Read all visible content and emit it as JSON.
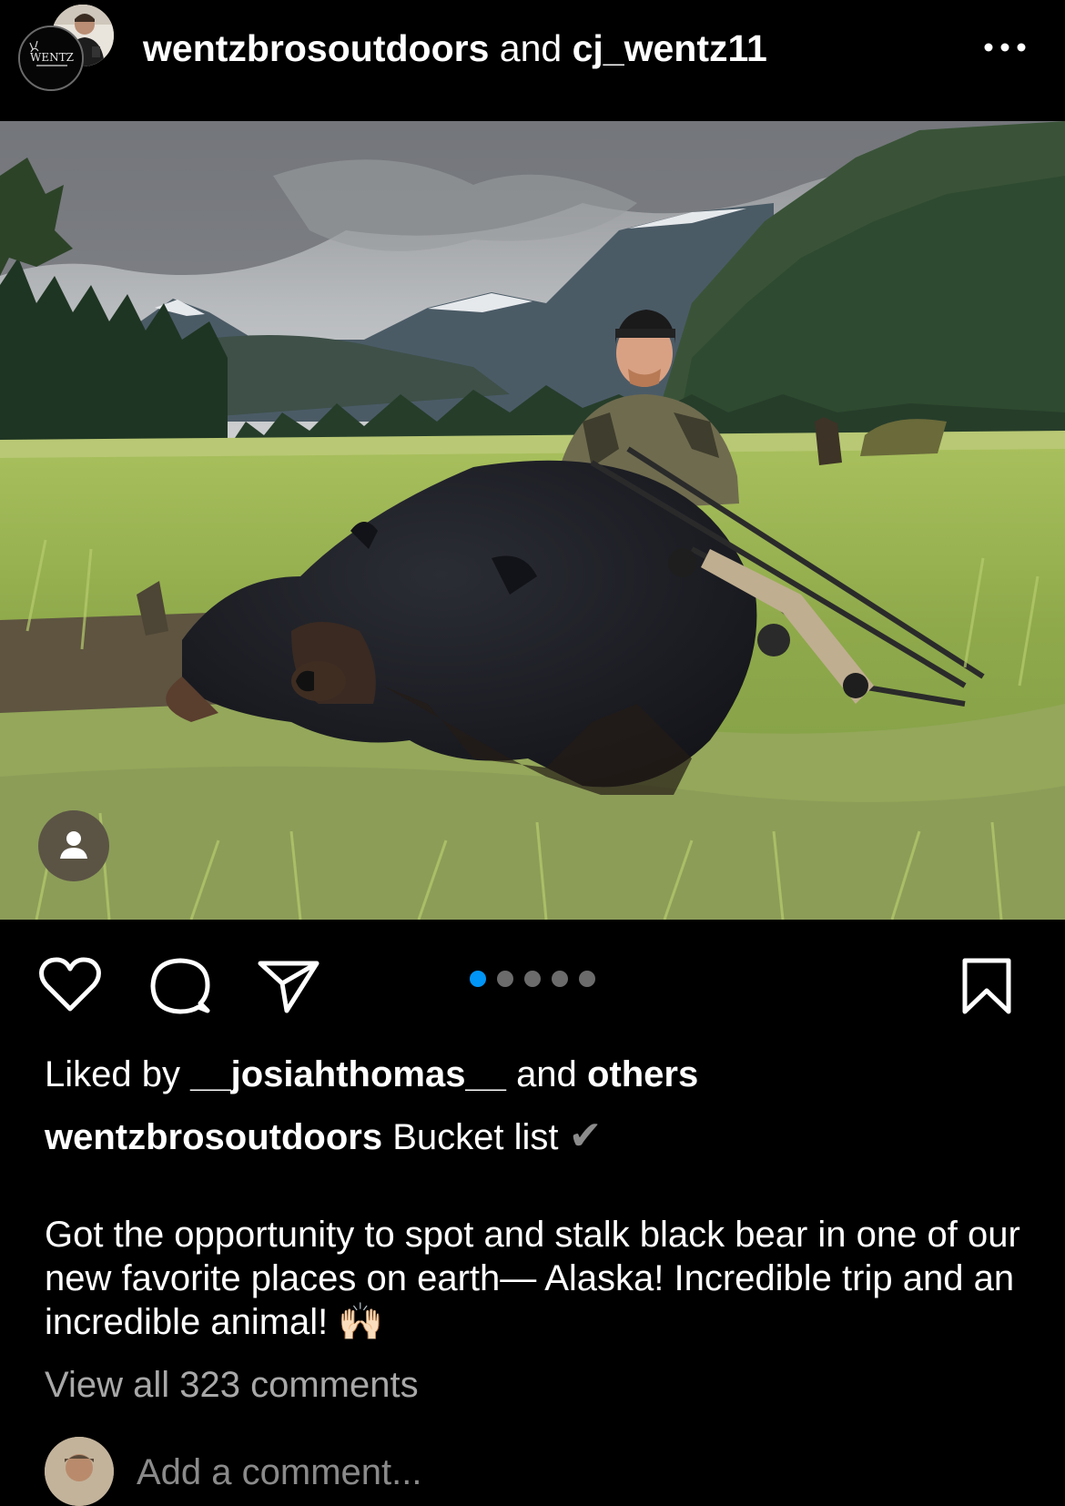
{
  "header": {
    "user1": "wentzbrosoutdoors",
    "connector": "and",
    "user2": "cj_wentz11",
    "logo_text": "WENTZ"
  },
  "post": {
    "image_alt": "Hunter kneeling behind a black bear with a compound bow in an Alaskan meadow with mountains",
    "carousel_total": 5,
    "carousel_active": 0
  },
  "likes": {
    "prefix": "Liked by",
    "user": "__josiahthomas__",
    "middle": "and",
    "suffix": "others"
  },
  "caption": {
    "username": "wentzbrosoutdoors",
    "headline": "Bucket list",
    "checkmark": "✔",
    "body": "Got the opportunity to spot and stalk black bear in one of our new favorite places on earth— Alaska! Incredible trip and an incredible animal! 🙌🏻"
  },
  "comments": {
    "view_all": "View all 323 comments",
    "placeholder": "Add a comment..."
  },
  "icons": {
    "more": "more-icon",
    "like": "heart-icon",
    "comment": "comment-bubble-icon",
    "share": "paper-plane-icon",
    "save": "bookmark-icon",
    "tag": "person-tag-icon"
  },
  "colors": {
    "background": "#000000",
    "text": "#ffffff",
    "muted": "#a8a8a8",
    "carousel_active": "#0095f6",
    "carousel_inactive": "#6b6b6b",
    "tag_button": "#5b5445"
  }
}
